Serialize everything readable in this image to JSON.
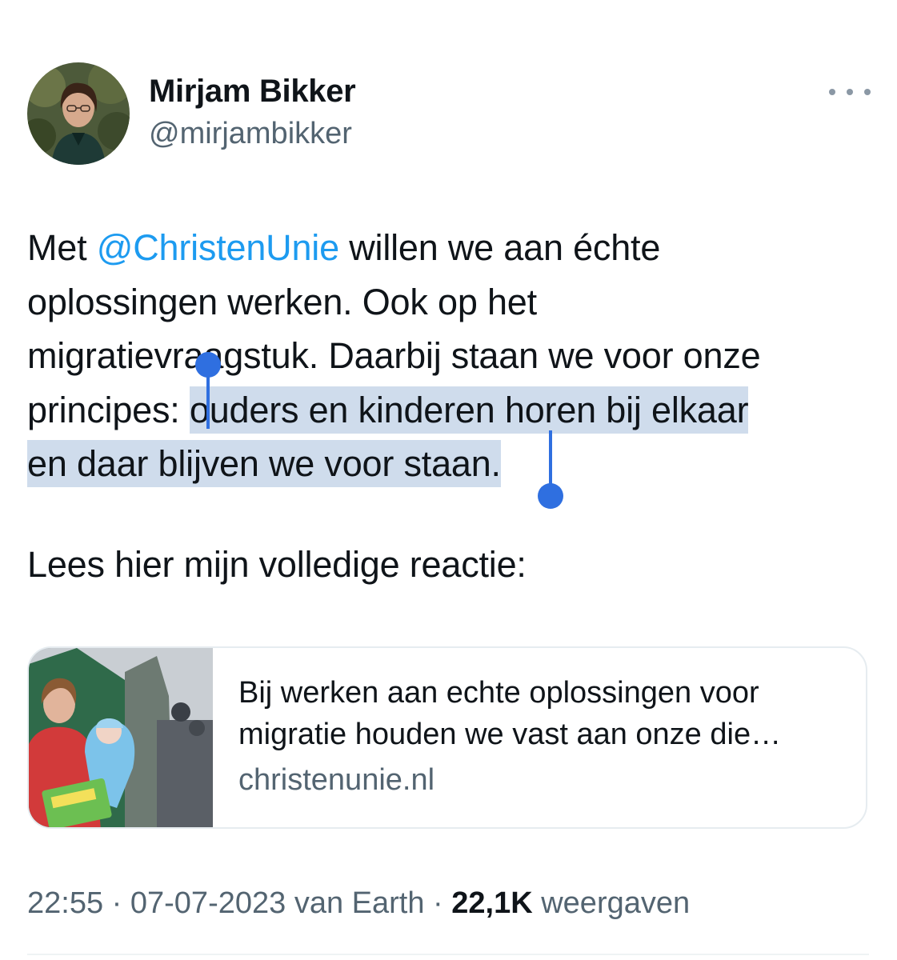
{
  "author": {
    "name": "Mirjam Bikker",
    "handle": "@mirjambikker"
  },
  "tweet": {
    "line1_pre": "Met ",
    "mention": "@ChristenUnie",
    "line1_post": " willen we aan échte",
    "line2": "oplossingen werken. Ook op het",
    "line3": "migratievraagstuk. Daarbij staan we voor onze",
    "line4_pre": "principes: ",
    "line4_sel": "ouders en kinderen horen bij elkaar",
    "line5_sel": "en daar blijven we voor staan.",
    "line6": "Lees hier mijn volledige reactie:"
  },
  "link_card": {
    "title_line1": "Bij werken aan echte oplossingen voor",
    "title_line2": "migratie houden we vast aan onze die…",
    "domain": "christenunie.nl"
  },
  "meta": {
    "time": "22:55",
    "sep1": " · ",
    "date": "07-07-2023",
    "source": " van Earth",
    "sep2": " · ",
    "views_count": "22,1K",
    "views_label": " weergaven"
  },
  "colors": {
    "mention": "#1d9bf0",
    "selection": "#cfdcec",
    "selection_handle": "#2f6fe0",
    "secondary_text": "#536471"
  },
  "icons": [
    "more-options-icon",
    "selection-start-handle-icon",
    "selection-end-handle-icon"
  ]
}
